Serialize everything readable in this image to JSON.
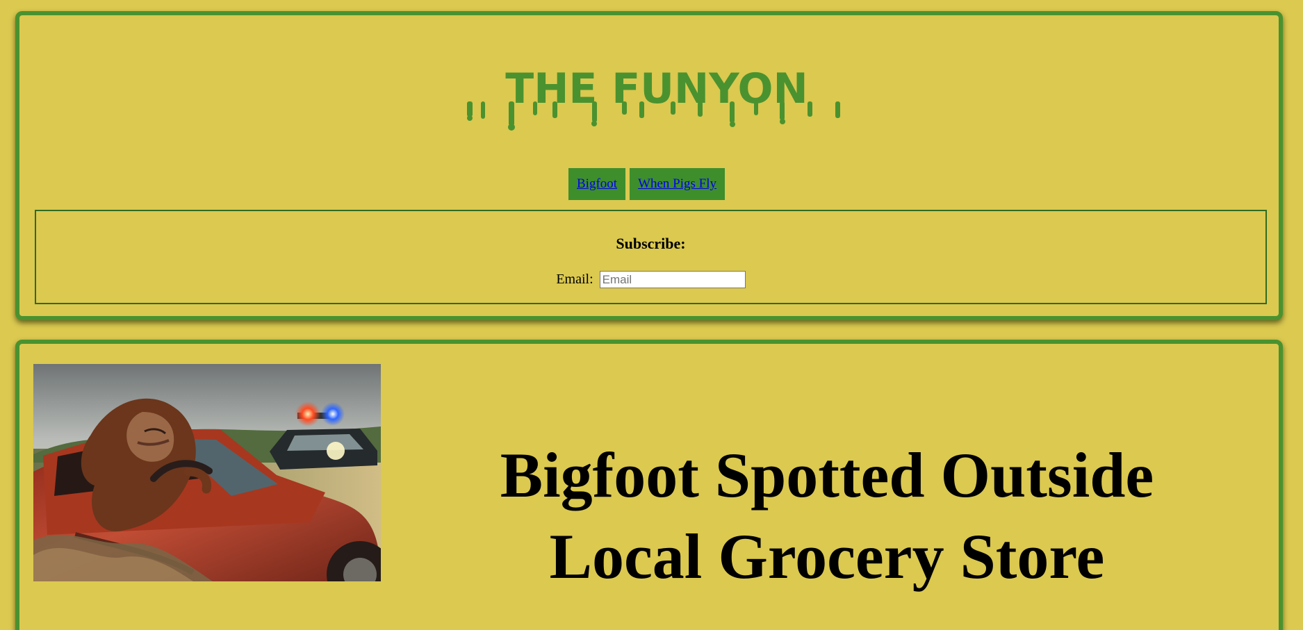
{
  "site": {
    "logo_text": "THE FUNYON"
  },
  "nav": {
    "items": [
      {
        "label": "Bigfoot"
      },
      {
        "label": "When Pigs Fly"
      }
    ]
  },
  "subscribe": {
    "title": "Subscribe:",
    "email_label": "Email:",
    "email_placeholder": "Email",
    "email_value": ""
  },
  "article": {
    "headline": "Bigfoot Spotted Outside Local Grocery Store",
    "image_alt": "Bigfoot driving a red pickup truck followed by a police car"
  },
  "colors": {
    "background": "#dbc950",
    "accent_green": "#4a922f",
    "link": "#0000ee"
  }
}
